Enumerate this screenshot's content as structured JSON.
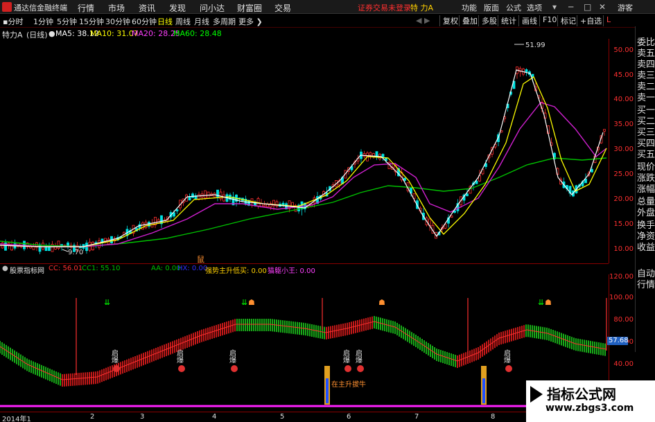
{
  "app": {
    "title": "通达信金融终端",
    "menu": [
      "行情",
      "市场",
      "资讯",
      "发现",
      "问小达",
      "财富圈",
      "交易"
    ],
    "login_status": "证券交易未登录",
    "stock_title": "特 力A",
    "right_menu": [
      "功能",
      "版面",
      "公式",
      "选项"
    ],
    "guest": "游客"
  },
  "toolbar": {
    "periods": [
      "分时",
      "1分钟",
      "5分钟",
      "15分钟",
      "30分钟",
      "60分钟",
      "日线",
      "周线",
      "月线",
      "多周期",
      "更多"
    ],
    "active_period": "日线",
    "tools": [
      "复权",
      "叠加",
      "多股",
      "统计",
      "画线",
      "F10",
      "标记",
      "+自选"
    ],
    "nav_arrows": "◀ ▶"
  },
  "info": {
    "stock": "特力A",
    "period_tag": "(日线)",
    "ma5": "MA5: 38.12",
    "ma10": "MA10: 31.07",
    "ma20": "MA20: 28.25",
    "ma60": "MA60: 28.48",
    "colors": {
      "ma5": "#ffffff",
      "ma10": "#ffff00",
      "ma20": "#ff40ff",
      "ma60": "#00ff00"
    }
  },
  "main_axis": {
    "ticks": [
      "50.00",
      "45.00",
      "40.00",
      "35.00",
      "30.00",
      "25.00",
      "20.00",
      "15.00",
      "10.00"
    ],
    "high_label": "51.99",
    "low_label": "9.70",
    "marker": "鼠"
  },
  "side_panel": [
    "委比",
    "卖五",
    "卖四",
    "卖三",
    "卖二",
    "卖一",
    "买一",
    "买二",
    "买三",
    "买四",
    "买五",
    "现价",
    "涨跌",
    "涨幅",
    "总量",
    "外盘",
    "换手",
    "净资",
    "收益",
    "自动",
    "行情"
  ],
  "indicator": {
    "name": "股票指标网",
    "cc": "CC: 56.01",
    "cc1": "CC1: 55.10",
    "aa": "AA: 0.00",
    "hx": "HX: 0.00",
    "qs": "强势主升低买: 0.00",
    "mx": "猫躯小王: 0.00",
    "ticks": [
      "120.00",
      "100.00",
      "80.00",
      "60.00",
      "40.00"
    ],
    "current_value": "57.68",
    "signal_label": "启爆",
    "annotation": "在主升拔牛"
  },
  "date_axis": [
    "2014年1",
    "2",
    "3",
    "4",
    "5",
    "6",
    "7",
    "8"
  ],
  "watermark": {
    "title": "指标公式网",
    "url": "www.zbgs3.com"
  }
}
